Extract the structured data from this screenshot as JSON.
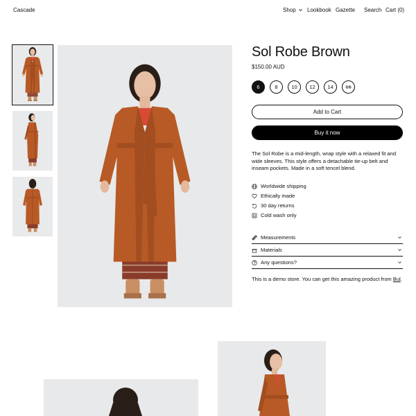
{
  "header": {
    "logo": "Cascade",
    "nav": {
      "shop": "Shop",
      "lookbook": "Lookbook",
      "gazette": "Gazette",
      "search": "Search",
      "cart": "Cart (0)"
    }
  },
  "product": {
    "title": "Sol Robe Brown",
    "price": "$150.00 AUD",
    "sizes": [
      {
        "label": "6",
        "state": "selected"
      },
      {
        "label": "8",
        "state": "available"
      },
      {
        "label": "10",
        "state": "available"
      },
      {
        "label": "12",
        "state": "available"
      },
      {
        "label": "14",
        "state": "available"
      },
      {
        "label": "16",
        "state": "sold-out"
      }
    ],
    "add_to_cart": "Add to Cart",
    "buy_now": "Buy it now",
    "description": "The Sol Robe is a mid-length, wrap style with a relaxed fit and wide sleeves. This style offers a detachable tie-up belt and inseam pockets. Made in a soft tencel blend.",
    "features": [
      {
        "icon": "globe-icon",
        "label": "Worldwide shipping"
      },
      {
        "icon": "heart-icon",
        "label": "Ethically made"
      },
      {
        "icon": "return-icon",
        "label": "30 day returns"
      },
      {
        "icon": "wash-icon",
        "label": "Cold wash only"
      }
    ],
    "accordions": [
      {
        "icon": "ruler-icon",
        "label": "Measurements"
      },
      {
        "icon": "hanger-icon",
        "label": "Materials"
      },
      {
        "icon": "question-icon",
        "label": "Any questions?"
      }
    ],
    "demo_text": "This is a demo store. You can get this amazing product from ",
    "demo_link": "Bul",
    "demo_end": "."
  },
  "colors": {
    "robe": "#b85a26",
    "robe_dark": "#9a4a1e",
    "background": "#e8e9ea",
    "accent": "#111111"
  }
}
